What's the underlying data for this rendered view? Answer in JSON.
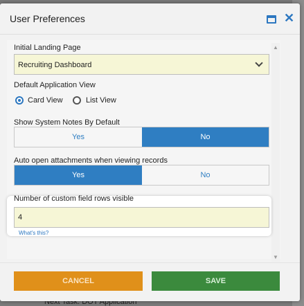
{
  "dialog": {
    "title": "User Preferences"
  },
  "fields": {
    "landing_page": {
      "label": "Initial Landing Page",
      "value": "Recruiting Dashboard"
    },
    "app_view": {
      "label": "Default Application View",
      "options": [
        {
          "label": "Card View",
          "checked": true
        },
        {
          "label": "List View",
          "checked": false
        }
      ]
    },
    "system_notes": {
      "label": "Show System Notes By Default",
      "yes_label": "Yes",
      "no_label": "No",
      "selected": "No"
    },
    "auto_open": {
      "label": "Auto open attachments when viewing records",
      "yes_label": "Yes",
      "no_label": "No",
      "selected": "Yes"
    },
    "custom_rows": {
      "label": "Number of custom field rows visible",
      "value": "4",
      "help_link": "What's this?"
    }
  },
  "buttons": {
    "cancel": "CANCEL",
    "save": "SAVE"
  },
  "background": {
    "bottom_text": "Next Task: DOT Application"
  },
  "colors": {
    "accent": "#2c77c0",
    "cancel": "#e0901a",
    "save": "#3b8a3d",
    "input_bg": "#f6f6d6"
  }
}
